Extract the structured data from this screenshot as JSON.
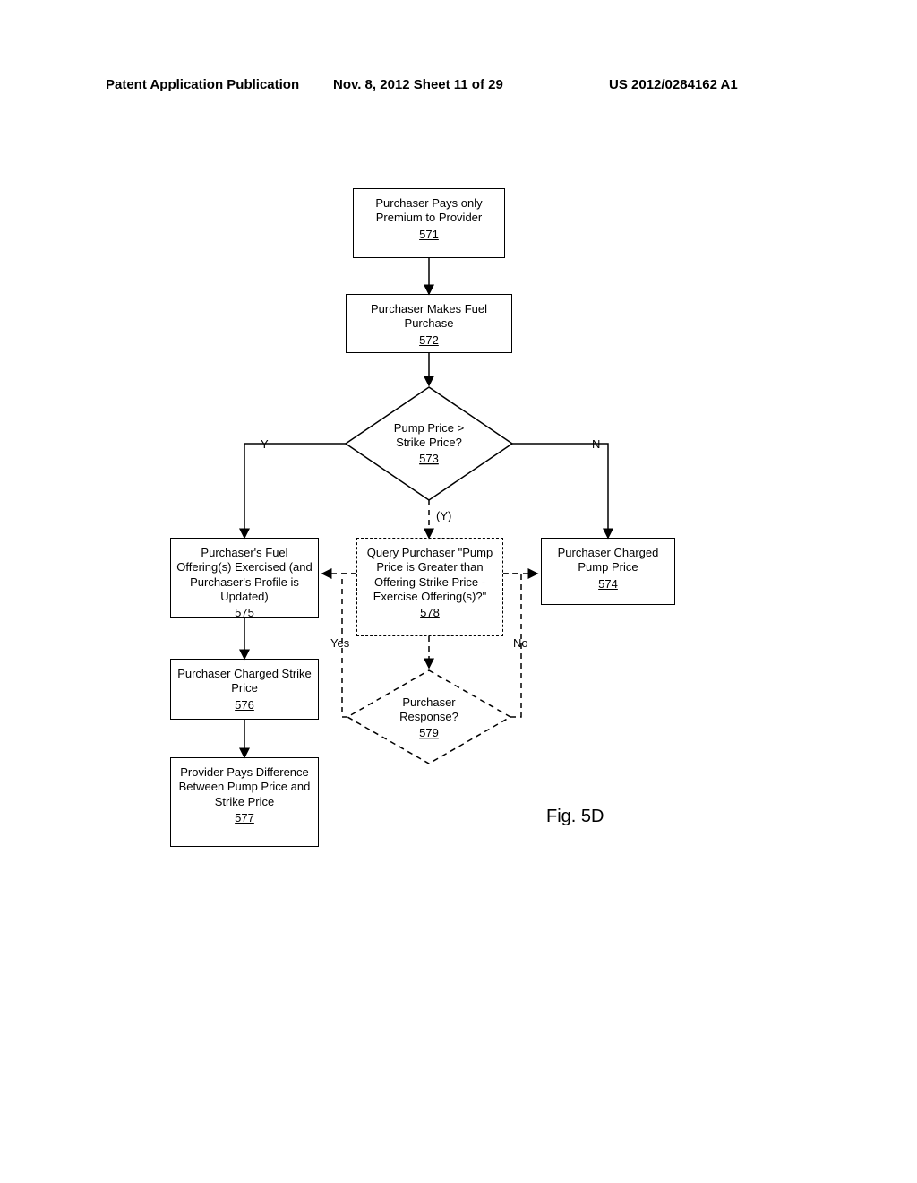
{
  "header": {
    "left": "Patent Application Publication",
    "mid": "Nov. 8, 2012  Sheet 11 of 29",
    "right": "US 2012/0284162 A1"
  },
  "chart_data": {
    "type": "diagram",
    "nodes": [
      {
        "id": "571",
        "text": "Purchaser Pays only Premium to Provider",
        "ref": "571",
        "shape": "rect"
      },
      {
        "id": "572",
        "text": "Purchaser Makes Fuel Purchase",
        "ref": "572",
        "shape": "rect"
      },
      {
        "id": "573",
        "text": "Pump Price > Strike Price?",
        "ref": "573",
        "shape": "diamond"
      },
      {
        "id": "574",
        "text": "Purchaser Charged Pump Price",
        "ref": "574",
        "shape": "rect"
      },
      {
        "id": "575",
        "text": "Purchaser's Fuel Offering(s) Exercised (and Purchaser's Profile is Updated)",
        "ref": "575",
        "shape": "rect"
      },
      {
        "id": "576",
        "text": "Purchaser Charged Strike Price",
        "ref": "576",
        "shape": "rect"
      },
      {
        "id": "577",
        "text": "Provider Pays Difference Between Pump Price and Strike Price",
        "ref": "577",
        "shape": "rect"
      },
      {
        "id": "578",
        "text": "Query Purchaser \"Pump Price is Greater than Offering Strike Price - Exercise Offering(s)?\"",
        "ref": "578",
        "shape": "rect",
        "style": "dashed"
      },
      {
        "id": "579",
        "text": "Purchaser Response?",
        "ref": "579",
        "shape": "diamond",
        "style": "dashed"
      }
    ],
    "edges": [
      {
        "from": "571",
        "to": "572"
      },
      {
        "from": "572",
        "to": "573"
      },
      {
        "from": "573",
        "to": "575",
        "label": "Y"
      },
      {
        "from": "573",
        "to": "574",
        "label": "N"
      },
      {
        "from": "573",
        "to": "578",
        "label": "(Y)"
      },
      {
        "from": "575",
        "to": "576"
      },
      {
        "from": "576",
        "to": "577"
      },
      {
        "from": "578",
        "to": "579"
      },
      {
        "from": "579",
        "to": "575",
        "label": "Yes"
      },
      {
        "from": "579",
        "to": "574",
        "label": "No"
      }
    ],
    "figure_label": "Fig. 5D"
  },
  "boxes": {
    "b571": {
      "text": "Purchaser Pays only Premium to Provider",
      "ref": "571"
    },
    "b572": {
      "text": "Purchaser Makes Fuel Purchase",
      "ref": "572"
    },
    "b574": {
      "text": "Purchaser Charged Pump Price",
      "ref": "574"
    },
    "b575": {
      "text": "Purchaser's Fuel Offering(s) Exercised (and Purchaser's Profile is Updated)",
      "ref": "575"
    },
    "b576": {
      "text": "Purchaser Charged Strike Price",
      "ref": "576"
    },
    "b577": {
      "text": "Provider Pays Difference Between Pump Price and Strike Price",
      "ref": "577"
    },
    "b578": {
      "text": "Query Purchaser \"Pump Price is Greater than Offering Strike Price - Exercise Offering(s)?\"",
      "ref": "578"
    }
  },
  "diamonds": {
    "d573": {
      "line1": "Pump Price >",
      "line2": "Strike Price?",
      "ref": "573"
    },
    "d579": {
      "line1": "Purchaser",
      "line2": "Response?",
      "ref": "579"
    }
  },
  "labels": {
    "Y": "Y",
    "N": "N",
    "Yalt": "(Y)",
    "Yes": "Yes",
    "No": "No"
  },
  "fig": "Fig. 5D"
}
